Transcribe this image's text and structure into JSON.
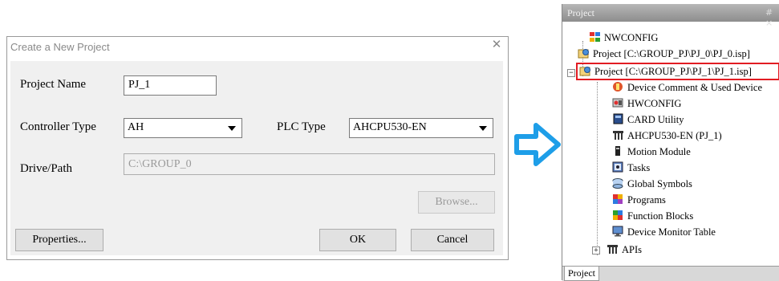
{
  "dialog": {
    "title": "Create a New Project",
    "project_name_label": "Project Name",
    "project_name_value": "PJ_1",
    "controller_type_label": "Controller Type",
    "controller_type_value": "AH",
    "plc_type_label": "PLC Type",
    "plc_type_value": "AHCPU530-EN",
    "drive_path_label": "Drive/Path",
    "drive_path_value": "C:\\GROUP_0",
    "browse_label": "Browse...",
    "properties_label": "Properties...",
    "ok_label": "OK",
    "cancel_label": "Cancel"
  },
  "arrow_color": "#1e9ee8",
  "tree": {
    "panel_title": "Project",
    "pin_label": "# ×",
    "items": [
      {
        "label": "NWCONFIG",
        "icon": "network-config-icon"
      },
      {
        "label": "Project [C:\\GROUP_PJ\\PJ_0\\PJ_0.isp]",
        "icon": "project-icon"
      },
      {
        "label": "Project [C:\\GROUP_PJ\\PJ_1\\PJ_1.isp]",
        "icon": "project-icon",
        "highlighted": true
      },
      {
        "label": "Device Comment & Used Device",
        "icon": "device-comment-icon"
      },
      {
        "label": "HWCONFIG",
        "icon": "hardware-config-icon"
      },
      {
        "label": "CARD Utility",
        "icon": "card-utility-icon"
      },
      {
        "label": "AHCPU530-EN  (PJ_1)",
        "icon": "cpu-icon"
      },
      {
        "label": "Motion Module",
        "icon": "motion-module-icon"
      },
      {
        "label": "Tasks",
        "icon": "tasks-icon"
      },
      {
        "label": "Global Symbols",
        "icon": "global-symbols-icon"
      },
      {
        "label": "Programs",
        "icon": "programs-icon"
      },
      {
        "label": "Function Blocks",
        "icon": "function-blocks-icon"
      },
      {
        "label": "Device Monitor Table",
        "icon": "device-monitor-icon"
      },
      {
        "label": "APIs",
        "icon": "apis-icon"
      }
    ],
    "tab_label": "Project",
    "highlight_color": "#e21c23"
  }
}
